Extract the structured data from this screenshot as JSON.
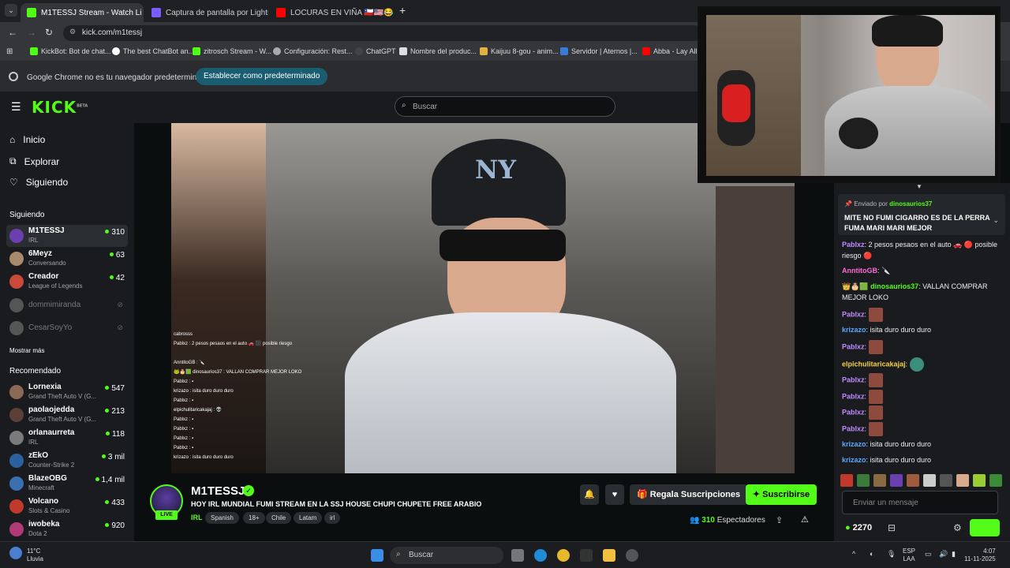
{
  "tabs": [
    {
      "title": "M1TESSJ Stream - Watch Li",
      "color": "#53fc18"
    },
    {
      "title": "Captura de pantalla por Lightsh",
      "color": "#7b5cff"
    },
    {
      "title": "LOCURAS EN VIÑA 🇨🇱🇺🇸😂 Pa",
      "color": "#ff0000"
    }
  ],
  "address": {
    "url": "kick.com/m1tessj"
  },
  "bookmarks": [
    "KickBot: Bot de chat...",
    "The best ChatBot an...",
    "zitrosch Stream - W...",
    "Configuración: Rest...",
    "ChatGPT",
    "Nombre del produc...",
    "Kaijuu 8-gou - anim...",
    "Servidor | Aternos |...",
    "Abba - Lay All"
  ],
  "infobar": {
    "message": "Google Chrome no es tu navegador predeterminado",
    "button": "Establecer como predeterminado"
  },
  "header": {
    "logo": "KICK",
    "beta": "BETA",
    "search_placeholder": "Buscar"
  },
  "sidebar": {
    "nav": [
      {
        "label": "Inicio",
        "icon": "home-icon"
      },
      {
        "label": "Explorar",
        "icon": "compass-icon"
      },
      {
        "label": "Siguiendo",
        "icon": "heart-icon"
      }
    ],
    "following_title": "Siguiendo",
    "following": [
      {
        "name": "M1TESSJ",
        "sub": "IRL",
        "viewers": "310",
        "color": "#6b3fb0"
      },
      {
        "name": "6Meyz",
        "sub": "Conversando",
        "viewers": "63",
        "color": "#a88a6b"
      },
      {
        "name": "Creador",
        "sub": "League of Legends",
        "viewers": "42",
        "color": "#c94a3a"
      },
      {
        "name": "dommimiranda",
        "sub": "",
        "viewers": "",
        "color": "#555"
      },
      {
        "name": "CesarSoyYo",
        "sub": "",
        "viewers": "",
        "color": "#555"
      }
    ],
    "show_more": "Mostrar más",
    "recommended_title": "Recomendado",
    "recommended": [
      {
        "name": "Lornexia",
        "sub": "Grand Theft Auto V (G...",
        "viewers": "547",
        "color": "#8a6a55"
      },
      {
        "name": "paolaojedda",
        "sub": "Grand Theft Auto V (G...",
        "viewers": "213",
        "color": "#5a4038"
      },
      {
        "name": "orlanaurreta",
        "sub": "IRL",
        "viewers": "118",
        "color": "#7a7a7a"
      },
      {
        "name": "zEkO",
        "sub": "Counter-Strike 2",
        "viewers": "3 mil",
        "color": "#2b5fa0"
      },
      {
        "name": "BlazeOBG",
        "sub": "Minecraft",
        "viewers": "1,4 mil",
        "color": "#3a6fb0"
      },
      {
        "name": "Volcano",
        "sub": "Slots & Casino",
        "viewers": "433",
        "color": "#c0392b"
      },
      {
        "name": "iwobeka",
        "sub": "Dota 2",
        "viewers": "920",
        "color": "#b03a78"
      }
    ]
  },
  "video_overlay_chat": [
    "cabrosss",
    "Pablxz : 2 pesos pesaos en el auto 🚗 ⬛ posible riesgo",
    "",
    "AnntitoGB : 🔪",
    "🐸🎂🟩 dinosaurios37 : VALLAN COMPRAR MEJOR LOKO",
    "Pablxz : ▪",
    "krizazo : isita duro duro duro",
    "Pablxz : ▪",
    "elpichulitaricakajaj : 👽",
    "Pablxz : ▪",
    "Pablxz : ▪",
    "Pablxz : ▪",
    "Pablxz : ▪",
    "krizazo : isita duro duro duro"
  ],
  "chat": {
    "pinned_by_label": "Enviado por",
    "pinned_user": "dinosaurios37",
    "pinned_text": "MITE NO FUMI CIGARRO ES DE LA PERRA FUMA MARI MARI MEJOR",
    "messages": [
      {
        "user": "Pablxz",
        "color": "#c08cff",
        "text": ": 2 pesos pesaos en el auto 🚗 🔴 posible riesgo 🔴"
      },
      {
        "user": "AnntitoGB",
        "color": "#ff6ad5",
        "text": ": 🔪"
      },
      {
        "user": "dinosaurios37",
        "color": "#53fc18",
        "text": ": VALLAN COMPRAR MEJOR LOKO"
      },
      {
        "user": "Pablxz",
        "color": "#c08cff",
        "text": ":"
      },
      {
        "user": "krizazo",
        "color": "#5aa9ff",
        "text": ": isita duro duro duro"
      },
      {
        "user": "Pablxz",
        "color": "#c08cff",
        "text": ":"
      },
      {
        "user": "elpichulitaricakajaj",
        "color": "#f5d142",
        "text": ":"
      },
      {
        "user": "Pablxz",
        "color": "#c08cff",
        "text": ":"
      },
      {
        "user": "Pablxz",
        "color": "#c08cff",
        "text": ":"
      },
      {
        "user": "Pablxz",
        "color": "#c08cff",
        "text": ":"
      },
      {
        "user": "Pablxz",
        "color": "#c08cff",
        "text": ":"
      },
      {
        "user": "krizazo",
        "color": "#5aa9ff",
        "text": ": isita duro duro duro"
      },
      {
        "user": "krizazo",
        "color": "#5aa9ff",
        "text": ": isita duro duro duro"
      }
    ],
    "input_placeholder": "Enviar un mensaje",
    "points": "2270"
  },
  "stream": {
    "name": "M1TESSJ",
    "live": "LIVE",
    "title": "HOY IRL MUNDIAL FUMI STREAM EN LA SSJ HOUSE CHUPI CHUPETE FREE ARABIO",
    "category": "IRL",
    "tags": [
      "Spanish",
      "18+",
      "Chile",
      "Latam",
      "irl"
    ],
    "gift_label": "Regala Suscripciones",
    "subscribe_label": "Suscribirse",
    "viewers": "310",
    "viewers_label": "Espectadores"
  },
  "taskbar": {
    "search_placeholder": "Buscar",
    "weather_temp": "11°C",
    "weather_desc": "Lluvia",
    "lang": "ESP",
    "lang_sub": "LAA",
    "time": "4:07",
    "date": "11-11-2025"
  },
  "colors": {
    "accent": "#53fc18",
    "background": "#0b0e0f",
    "panel": "#191b1f"
  }
}
